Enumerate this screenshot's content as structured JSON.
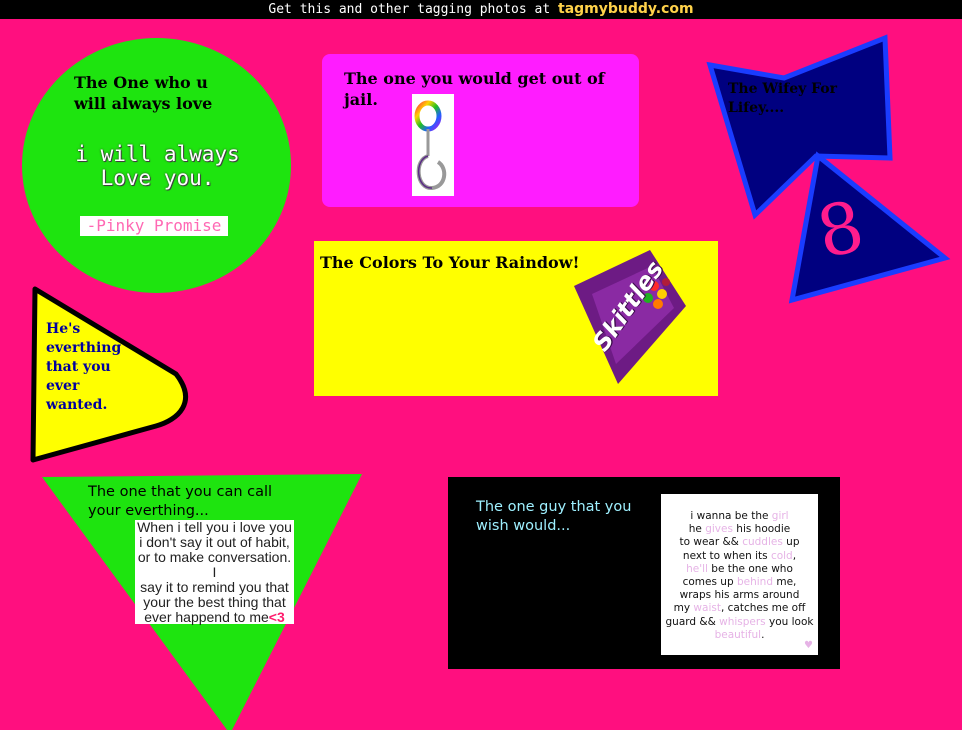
{
  "banner": {
    "prefix": "Get this and other tagging photos at",
    "site": "tagmybuddy.com"
  },
  "colors": {
    "background": "#ff0f7f",
    "green": "#1ee40f",
    "yellow": "#ffff00",
    "magenta": "#ff1cff",
    "navy": "#000080",
    "blue": "#1a3cff"
  },
  "circle": {
    "heading_line1": "The One who u",
    "heading_line2": "will always love",
    "sticker_line1": "i will always",
    "sticker_line2": "Love you.",
    "sticker_line3": "-Pinky Promise"
  },
  "jail": {
    "heading_line1": "The one you would get out of",
    "heading_line2": "jail.",
    "icon": "handcuff-key-icon"
  },
  "wifey": {
    "heading_line1": "The Wifey For",
    "heading_line2": "Lifey....",
    "doodle": "8"
  },
  "rainbow": {
    "heading": "The Colors To Your Raindow!",
    "candy_label": "Skittles"
  },
  "pennant": {
    "lines": [
      "He's",
      "everthing",
      "that you",
      "ever",
      "wanted."
    ]
  },
  "triangle": {
    "heading_line1": "The one that you can call",
    "heading_line2": "your everthing...",
    "quote_lines": [
      "When i tell you i love you",
      "i don't say it out of habit,",
      "or to make conversation. I",
      "say it to remind you that",
      "your the best thing that",
      "ever happend to me"
    ],
    "heart": "<3"
  },
  "wish": {
    "heading_line1": "The one guy that you",
    "heading_line2": "wish would...",
    "l1a": "i wanna be the ",
    "l1b": "girl",
    "l2a": "he ",
    "l2b": "gives",
    "l2c": " his hoodie",
    "l3a": "to wear && ",
    "l3b": "cuddles",
    "l3c": " up",
    "l4a": "next to when its ",
    "l4b": "cold",
    "l4c": ",",
    "l5a": "he'll",
    "l5b": " be the one who",
    "l6a": "comes up ",
    "l6b": "behind",
    "l6c": " me,",
    "l7": "wraps his arms around",
    "l8a": "my ",
    "l8b": "waist",
    "l8c": ", catches me off",
    "l9a": "guard && ",
    "l9b": "whispers",
    "l9c": " you look",
    "l10a": "beautiful",
    "l10b": "."
  }
}
